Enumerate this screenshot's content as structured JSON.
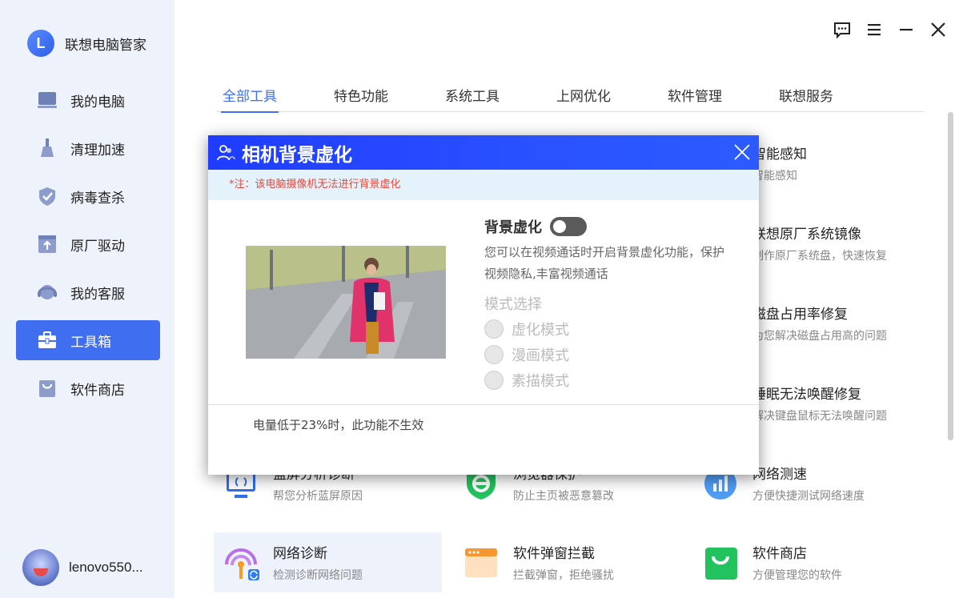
{
  "sidebar": {
    "brand_logo_letter": "L",
    "brand_name": "联想电脑管家",
    "items": [
      {
        "label": "我的电脑",
        "icon": "laptop-icon"
      },
      {
        "label": "清理加速",
        "icon": "broom-icon"
      },
      {
        "label": "病毒查杀",
        "icon": "shield-icon"
      },
      {
        "label": "原厂驱动",
        "icon": "upload-box-icon"
      },
      {
        "label": "我的客服",
        "icon": "headset-icon"
      },
      {
        "label": "工具箱",
        "icon": "toolbox-icon",
        "active": true
      },
      {
        "label": "软件商店",
        "icon": "shopping-bag-icon"
      }
    ],
    "username": "lenovo550..."
  },
  "window_controls": [
    "feedback-icon",
    "menu-icon",
    "minimize-icon",
    "close-icon"
  ],
  "tabs": [
    {
      "label": "全部工具",
      "active": true
    },
    {
      "label": "特色功能"
    },
    {
      "label": "系统工具"
    },
    {
      "label": "上网优化"
    },
    {
      "label": "软件管理"
    },
    {
      "label": "联想服务"
    }
  ],
  "tools": {
    "smart_sense": {
      "name": "智能感知",
      "desc": "智能感知"
    },
    "system_image": {
      "name": "联想原厂系统镜像",
      "desc": "制作原厂系统盘，快速恢复"
    },
    "disk_fix": {
      "name": "磁盘占用率修复",
      "desc": "为您解决磁盘占用高的问题"
    },
    "sleep_fix": {
      "name": "睡眠无法唤醒修复",
      "desc": "解决键盘鼠标无法唤醒问题"
    },
    "bluescreen": {
      "name": "蓝屏分析诊断",
      "desc": "帮您分析蓝屏原因"
    },
    "browser_guard": {
      "name": "浏览器保护",
      "desc": "防止主页被恶意篡改"
    },
    "speed_test": {
      "name": "网络测速",
      "desc": "方便快捷测试网络速度"
    },
    "net_diag": {
      "name": "网络诊断",
      "desc": "检测诊断网络问题"
    },
    "popup_block": {
      "name": "软件弹窗拦截",
      "desc": "拦截弹窗，拒绝骚扰"
    },
    "soft_store": {
      "name": "软件商店",
      "desc": "方便管理您的软件"
    }
  },
  "modal": {
    "title": "相机背景虚化",
    "notice": "*注：该电脑摄像机无法进行背景虚化",
    "bg_label": "背景虚化",
    "bg_enabled": false,
    "desc": "您可以在视频通话时开启背景虚化功能，保护视频隐私,丰富视频通话",
    "mode_title": "模式选择",
    "modes": [
      "虚化模式",
      "漫画模式",
      "素描模式"
    ],
    "footer": "电量低于23%时，此功能不生效"
  },
  "colors": {
    "accent": "#3f6ef1",
    "modal_header": "#1f3cff",
    "notice_text": "#e8493d"
  }
}
